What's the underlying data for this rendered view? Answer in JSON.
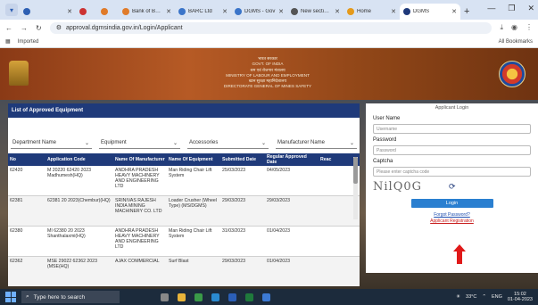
{
  "browser": {
    "tabs": [
      {
        "label": "",
        "color": "#2d5fb3"
      },
      {
        "label": "",
        "color": "#3a74c9"
      },
      {
        "label": "",
        "color": "#cc3333"
      },
      {
        "label": "Bank of Baroda",
        "color": "#e07b2a"
      },
      {
        "label": "BARC Ltd",
        "color": "#3a74c9"
      },
      {
        "label": "DGMS - Gov",
        "color": "#3a74c9"
      },
      {
        "label": "New sections",
        "color": "#555555"
      },
      {
        "label": "Home",
        "color": "#e59a1b"
      },
      {
        "label": "DGMS",
        "color": "#1f3a7a",
        "active": true
      }
    ],
    "url": "approval.dgmsindia.gov.in/Login/Applicant",
    "bookmarks": [
      "Apps",
      "Imported"
    ],
    "all_bookmarks": "All Bookmarks"
  },
  "header": {
    "lines": [
      "भारत सरकार",
      "GOVT. OF INDIA",
      "श्रम एवं रोजगार मंत्रालय",
      "MINISTRY OF LABOUR AND EMPLOYMENT",
      "खान सुरक्षा महानिदेशालय",
      "DIRECTORATE GENERAL OF MINES SAFETY"
    ]
  },
  "equipment": {
    "title": "List of Approved Equipment",
    "filters": [
      "Department Name",
      "Equipment",
      "Accessories",
      "Manufacturer Name"
    ],
    "columns": [
      "No",
      "Application Code",
      "Name Of Manufacturer",
      "Name Of Equipment",
      "Submitted Date",
      "Regular Approved Date",
      "Reac"
    ],
    "rows": [
      {
        "no": "62420",
        "code": "M 20220 62420 2023 Madhumesh(HQ)",
        "manufacturer": "ANDHRA PRADESH HEAVY MACHINERY AND ENGINEERING LTD",
        "equipment": "Man Riding Chair Lift System",
        "submitted": "25/03/2023",
        "approved": "04/05/2023",
        "reac": ""
      },
      {
        "no": "62381",
        "code": "62381 20 2023(Chembur)(HQ)",
        "manufacturer": "SRINIVAS RAJESH INDIA MINING MACHINERY CO. LTD",
        "equipment": "Loader Crusher (Wheel Type) (MS/DGMS)",
        "submitted": "29/03/2023",
        "approved": "29/03/2023",
        "reac": ""
      },
      {
        "no": "62380",
        "code": "MI 62380 20 2023 Shanthalaxmi(HQ)",
        "manufacturer": "ANDHRA PRADESH HEAVY MACHINERY AND ENGINEERING LTD",
        "equipment": "Man Riding Chair Lift System",
        "submitted": "31/03/2023",
        "approved": "01/04/2023",
        "reac": ""
      },
      {
        "no": "62362",
        "code": "MSE 29022 62362 2023 (MSE(HQ)",
        "manufacturer": "AJAX COMMERCIAL",
        "equipment": "Surf Blast",
        "submitted": "29/03/2023",
        "approved": "01/04/2023",
        "reac": ""
      }
    ]
  },
  "login": {
    "title": "Applicant Login",
    "user_label": "User Name",
    "user_placeholder": "Username",
    "password_label": "Password",
    "password_placeholder": "Password",
    "captcha_label": "Captcha",
    "captcha_placeholder": "Please enter captcha code",
    "captcha_text": "NilQ0G",
    "login_button": "Login",
    "forgot_link": "Forgot Password?",
    "register_link": "Applicant Registration"
  },
  "taskbar": {
    "search_placeholder": "Type here to search",
    "weather": "33°C",
    "time": "15:02",
    "date": "01-04-2023",
    "lang": "ENG"
  }
}
